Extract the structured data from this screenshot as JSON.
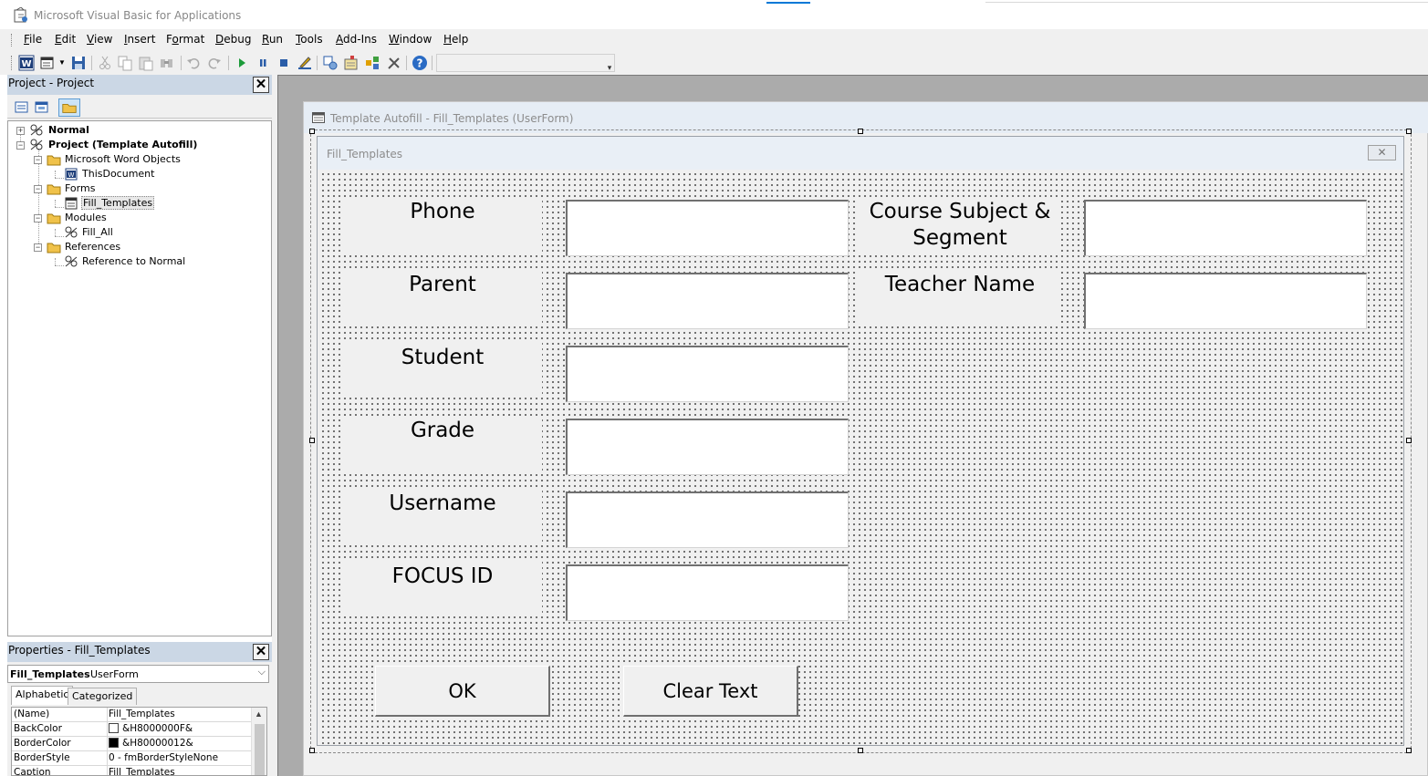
{
  "window": {
    "title": "Microsoft Visual Basic for Applications"
  },
  "menu": {
    "items": [
      {
        "label": "File",
        "accel": "F",
        "rest": "ile"
      },
      {
        "label": "Edit",
        "accel": "E",
        "rest": "dit"
      },
      {
        "label": "View",
        "accel": "V",
        "rest": "iew"
      },
      {
        "label": "Insert",
        "accel": "I",
        "rest": "nsert"
      },
      {
        "label": "Format",
        "accel": "o",
        "pre": "F",
        "rest": "rmat"
      },
      {
        "label": "Debug",
        "accel": "D",
        "rest": "ebug"
      },
      {
        "label": "Run",
        "accel": "R",
        "rest": "un"
      },
      {
        "label": "Tools",
        "accel": "T",
        "rest": "ools"
      },
      {
        "label": "Add-Ins",
        "accel": "A",
        "rest": "dd-Ins"
      },
      {
        "label": "Window",
        "accel": "W",
        "rest": "indow"
      },
      {
        "label": "Help",
        "accel": "H",
        "rest": "elp"
      }
    ]
  },
  "toolbar": {
    "icons": [
      "word-icon",
      "insert-userform-icon",
      "save-icon",
      "cut-icon",
      "copy-icon",
      "paste-icon",
      "find-icon",
      "undo-icon",
      "redo-icon",
      "run-icon",
      "break-icon",
      "reset-icon",
      "design-mode-icon",
      "project-explorer-icon",
      "properties-window-icon",
      "object-browser-icon",
      "toolbox-icon",
      "help-icon"
    ]
  },
  "project_panel": {
    "title": "Project - Project",
    "tree": [
      {
        "label": "Normal",
        "bold": true
      },
      {
        "label": "Project (Template Autofill)",
        "bold": true
      },
      {
        "label": "Microsoft Word Objects"
      },
      {
        "label": "ThisDocument"
      },
      {
        "label": "Forms"
      },
      {
        "label": "Fill_Templates",
        "selected": true
      },
      {
        "label": "Modules"
      },
      {
        "label": "Fill_All"
      },
      {
        "label": "References"
      },
      {
        "label": "Reference to Normal"
      }
    ]
  },
  "properties_panel": {
    "title": "Properties - Fill_Templates",
    "object_name": "Fill_Templates",
    "object_type": "UserForm",
    "tabs": [
      "Alphabetic",
      "Categorized"
    ],
    "rows": [
      {
        "key": "(Name)",
        "value": "Fill_Templates"
      },
      {
        "key": "BackColor",
        "value": "&H8000000F&",
        "swatch": "#ffffff"
      },
      {
        "key": "BorderColor",
        "value": "&H80000012&",
        "swatch": "#000000"
      },
      {
        "key": "BorderStyle",
        "value": "0 - fmBorderStyleNone"
      },
      {
        "key": "Caption",
        "value": "Fill_Templates"
      }
    ]
  },
  "designer": {
    "title": "Template Autofill - Fill_Templates (UserForm)",
    "form_caption": "Fill_Templates",
    "close_glyph": "✕",
    "labels": {
      "phone": "Phone",
      "parent": "Parent",
      "student": "Student",
      "grade": "Grade",
      "username": "Username",
      "focus_id": "FOCUS ID",
      "course_line1": "Course Subject &",
      "course_line2": "Segment",
      "teacher": "Teacher Name"
    },
    "buttons": {
      "ok": "OK",
      "clear": "Clear Text"
    }
  }
}
